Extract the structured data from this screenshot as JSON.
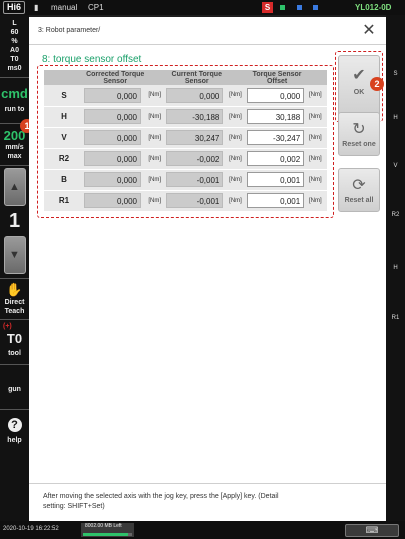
{
  "topbar": {
    "robot_model": "Hi6",
    "mode": "manual",
    "program": "CP1",
    "status_icon": "S",
    "controller_id": "YL012-0D",
    "colors": {
      "status_red": "#d62a2a",
      "indicator_green": "#2ec26a",
      "indicator_blue": "#3a7ae0"
    }
  },
  "left_panel": {
    "param_l_label": "L",
    "param_l_value": "60",
    "param_percent": "%",
    "param_a0": "A0",
    "param_t0": "T0",
    "param_ms0": "ms0",
    "cmd_label": "cmd",
    "run_to_label": "run to",
    "run_to_badge": "1",
    "speed_value": "200",
    "speed_unit": "mm/s",
    "speed_mode": "max",
    "jog_level": "1",
    "direct_teach_line1": "Direct",
    "direct_teach_line2": "Teach",
    "tool_marker": "(+)",
    "tool_value": "T0",
    "tool_label": "tool",
    "gun_label": "gun",
    "help_label": "help"
  },
  "right_panel": {
    "labels": [
      "S",
      "H",
      "V",
      "R2",
      "H",
      "R1"
    ]
  },
  "dialog": {
    "breadcrumb": "3: Robot parameter/",
    "section_title": "8: torque sensor offset",
    "columns": [
      "Corrected Torque Sensor",
      "Current Torque Sensor",
      "Torque Sensor Offset"
    ],
    "unit": "[Nm]",
    "rows": [
      {
        "axis": "S",
        "corrected": "0,000",
        "current": "0,000",
        "offset": "0,000"
      },
      {
        "axis": "H",
        "corrected": "0,000",
        "current": "-30,188",
        "offset": "30,188"
      },
      {
        "axis": "V",
        "corrected": "0,000",
        "current": "30,247",
        "offset": "-30,247"
      },
      {
        "axis": "R2",
        "corrected": "0,000",
        "current": "-0,002",
        "offset": "0,002"
      },
      {
        "axis": "B",
        "corrected": "0,000",
        "current": "-0,001",
        "offset": "0,001"
      },
      {
        "axis": "R1",
        "corrected": "0,000",
        "current": "-0,001",
        "offset": "0,001"
      }
    ],
    "ok_label": "OK",
    "ok_badge": "2",
    "reset_one_label": "Reset one",
    "reset_all_label": "Reset all",
    "message_line1": "After moving the selected axis with the jog key, press the [Apply] key.  (Detail",
    "message_line2": "setting: SHIFT+Set)"
  },
  "bottombar": {
    "datetime": "2020-10-19 16:22:52",
    "memory_text": "8002.00 MB Left",
    "memory_fill_fraction": 0.92
  }
}
